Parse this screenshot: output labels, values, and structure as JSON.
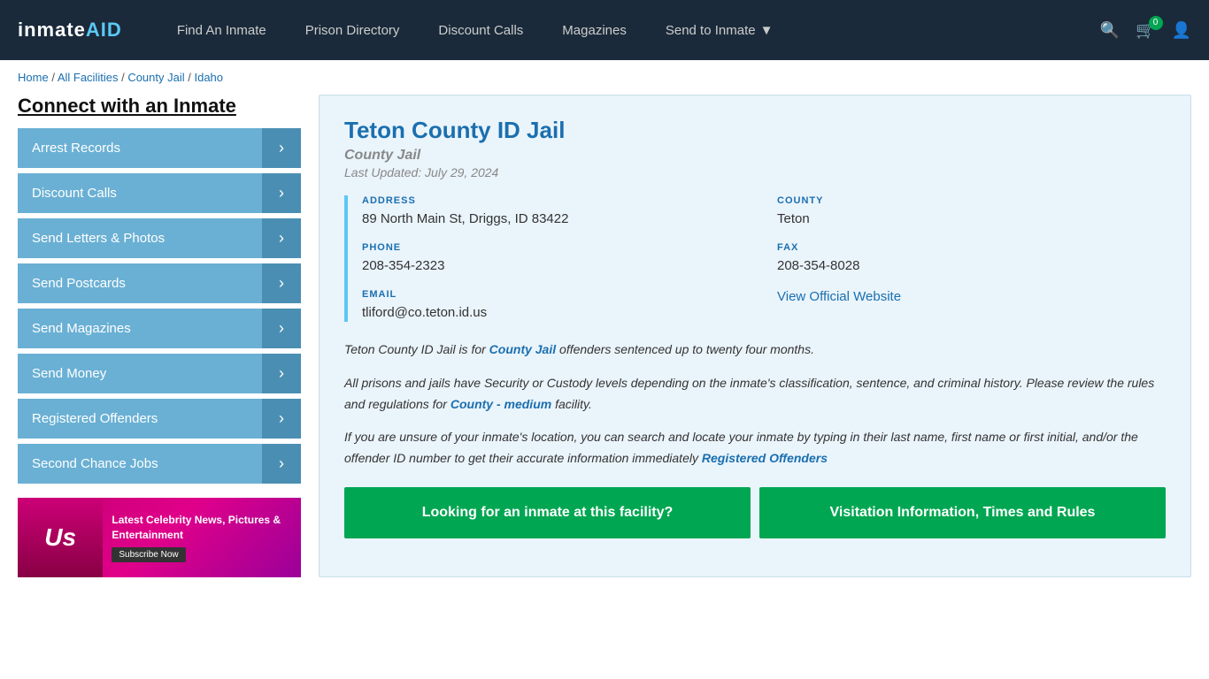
{
  "nav": {
    "logo": "inmate",
    "logo_aid": "AID",
    "links": [
      {
        "label": "Find An Inmate",
        "id": "find-inmate"
      },
      {
        "label": "Prison Directory",
        "id": "prison-directory"
      },
      {
        "label": "Discount Calls",
        "id": "discount-calls"
      },
      {
        "label": "Magazines",
        "id": "magazines"
      },
      {
        "label": "Send to Inmate",
        "id": "send-to-inmate",
        "dropdown": true
      }
    ],
    "cart_count": "0"
  },
  "breadcrumb": {
    "home": "Home",
    "all_facilities": "All Facilities",
    "county_jail": "County Jail",
    "state": "Idaho",
    "sep": " / "
  },
  "sidebar": {
    "title": "Connect with an Inmate",
    "buttons": [
      "Arrest Records",
      "Discount Calls",
      "Send Letters & Photos",
      "Send Postcards",
      "Send Magazines",
      "Send Money",
      "Registered Offenders",
      "Second Chance Jobs"
    ],
    "ad": {
      "brand": "Us",
      "title": "Latest Celebrity News, Pictures & Entertainment",
      "cta": "Subscribe Now"
    }
  },
  "facility": {
    "title": "Teton County ID Jail",
    "type": "County Jail",
    "updated": "Last Updated: July 29, 2024",
    "address_label": "ADDRESS",
    "address_value": "89 North Main St, Driggs, ID 83422",
    "county_label": "COUNTY",
    "county_value": "Teton",
    "phone_label": "PHONE",
    "phone_value": "208-354-2323",
    "fax_label": "FAX",
    "fax_value": "208-354-8028",
    "email_label": "EMAIL",
    "email_value": "tliford@co.teton.id.us",
    "website_label": "View Official Website",
    "desc1": "Teton County ID Jail is for County Jail offenders sentenced up to twenty four months.",
    "desc1_link": "County Jail",
    "desc2": "All prisons and jails have Security or Custody levels depending on the inmate’s classification, sentence, and criminal history. Please review the rules and regulations for County - medium facility.",
    "desc2_link": "County - medium",
    "desc3": "If you are unsure of your inmate’s location, you can search and locate your inmate by typing in their last name, first name or first initial, and/or the offender ID number to get their accurate information immediately Registered Offenders",
    "desc3_link": "Registered Offenders",
    "btn1": "Looking for an inmate at this facility?",
    "btn2": "Visitation Information, Times and Rules"
  }
}
